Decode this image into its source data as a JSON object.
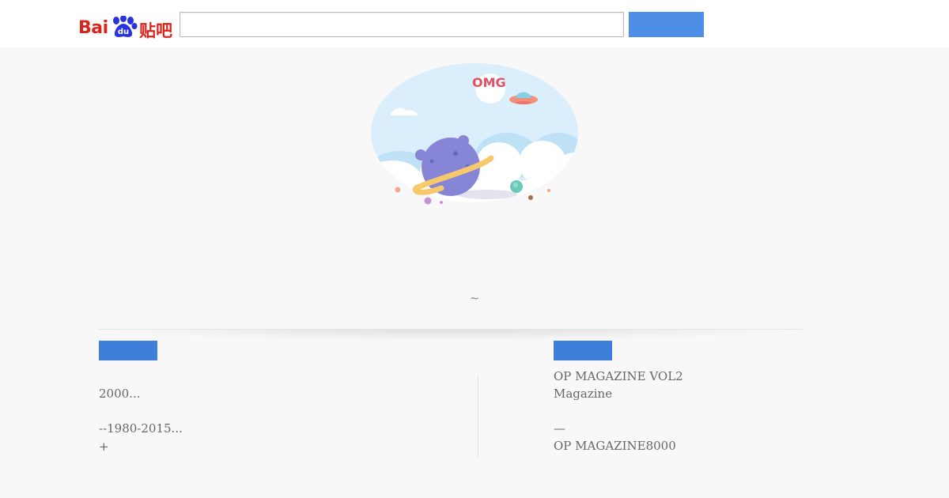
{
  "header": {
    "logo": {
      "latin_text": "Bai",
      "du_text": "du",
      "cn_text": "贴吧"
    },
    "search": {
      "value": "",
      "placeholder": ""
    },
    "search_button_label": ""
  },
  "illustration": {
    "badge_text": "OMG",
    "icon_names": [
      "planet-icon",
      "ufo-icon",
      "cloud-icon"
    ]
  },
  "main": {
    "tilde_text": "~"
  },
  "left_section": {
    "tab_label": "",
    "lines": [
      "2000...",
      "--1980-2015...",
      "+"
    ]
  },
  "right_section": {
    "tab_label": "",
    "lines": [
      "OP MAGAZINE VOL2",
      "Magazine",
      "—",
      "OP MAGAZINE8000"
    ]
  },
  "colors": {
    "brand_red": "#d9261c",
    "brand_blue": "#2932e1",
    "button_blue": "#4e8ee6",
    "tab_blue": "#3f7fdc"
  }
}
